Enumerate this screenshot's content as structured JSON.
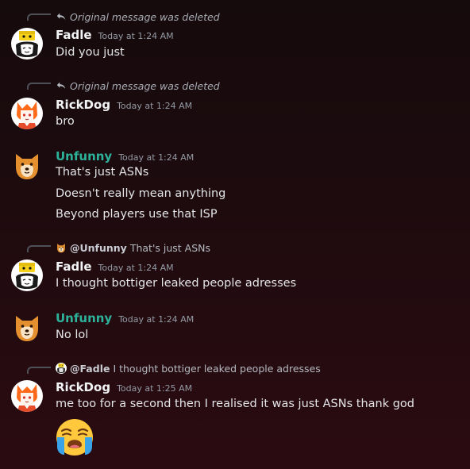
{
  "messages": [
    {
      "reply": {
        "type": "deleted",
        "text": "Original message was deleted"
      },
      "author": "Fadle",
      "timestamp": "Today at 1:24 AM",
      "lines": [
        "Did you just"
      ],
      "avatar": "fadle-avatar"
    },
    {
      "reply": {
        "type": "deleted",
        "text": "Original message was deleted"
      },
      "author": "RickDog",
      "timestamp": "Today at 1:24 AM",
      "lines": [
        "bro"
      ],
      "avatar": "rickdog-avatar"
    },
    {
      "author": "Unfunny",
      "timestamp": "Today at 1:24 AM",
      "lines": [
        "That's just ASNs",
        "Doesn't really mean anything",
        "Beyond players use that ISP"
      ],
      "avatar": "unfunny-avatar"
    },
    {
      "reply": {
        "type": "quote",
        "author": "@Unfunny",
        "text": "That's just ASNs"
      },
      "author": "Fadle",
      "timestamp": "Today at 1:24 AM",
      "lines": [
        "I thought bottiger leaked people  adresses"
      ],
      "avatar": "fadle-avatar"
    },
    {
      "author": "Unfunny",
      "timestamp": "Today at 1:24 AM",
      "lines": [
        "No lol"
      ],
      "avatar": "unfunny-avatar"
    },
    {
      "reply": {
        "type": "quote",
        "author": "@Fadle",
        "text": "I thought bottiger leaked people adresses"
      },
      "author": "RickDog",
      "timestamp": "Today at 1:25 AM",
      "lines": [
        "me too for a second then I realised it was just ASNs thank god"
      ],
      "emoji": "loudly-crying-face-icon",
      "avatar": "rickdog-avatar"
    }
  ],
  "colors": {
    "unfunny_name": "#2cb39a",
    "background": "#1c0b0e"
  }
}
